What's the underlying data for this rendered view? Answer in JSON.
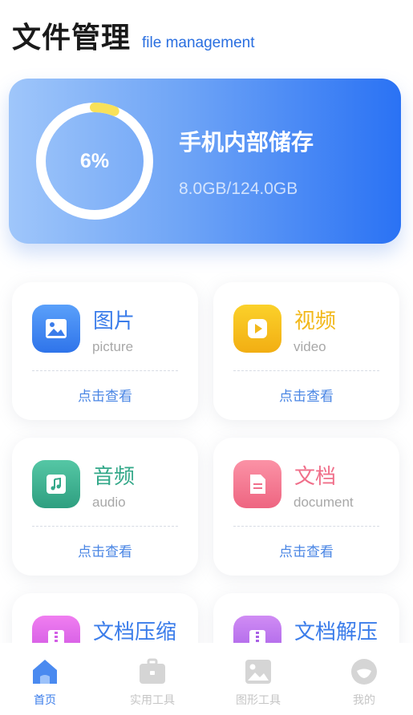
{
  "header": {
    "title": "文件管理",
    "subtitle": "file management"
  },
  "storage": {
    "name": "手机内部储存",
    "percent_label": "6%",
    "usage_text": "8.0GB/124.0GB",
    "used_fraction": 0.06
  },
  "categories": [
    {
      "label": "图片",
      "sub": "picture",
      "link": "点击查看",
      "color": "#3a7cea",
      "icon": "image-icon"
    },
    {
      "label": "视频",
      "sub": "video",
      "link": "点击查看",
      "color": "#f2b81a",
      "icon": "play-icon"
    },
    {
      "label": "音频",
      "sub": "audio",
      "link": "点击查看",
      "color": "#33a889",
      "icon": "music-icon"
    },
    {
      "label": "文档",
      "sub": "document",
      "link": "点击查看",
      "color": "#f06f8a",
      "icon": "document-icon"
    },
    {
      "label": "文档压缩",
      "color": "#3a7cea",
      "icon": "zip-icon"
    },
    {
      "label": "文档解压",
      "color": "#3a7cea",
      "icon": "unzip-icon"
    }
  ],
  "tabs": [
    {
      "label": "首页",
      "icon": "home-icon",
      "active": true
    },
    {
      "label": "实用工具",
      "icon": "toolbox-icon"
    },
    {
      "label": "图形工具",
      "icon": "image-icon"
    },
    {
      "label": "我的",
      "icon": "profile-icon"
    }
  ],
  "colors": {
    "accent": "#3a7cea",
    "ring_fill": "#f9e15a"
  }
}
